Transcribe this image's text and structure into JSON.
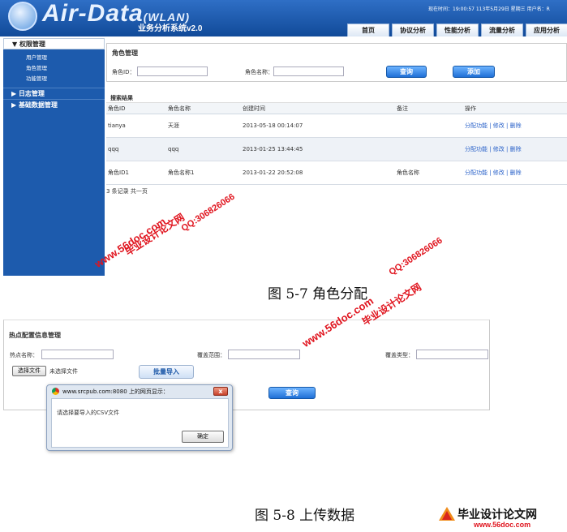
{
  "screen1": {
    "logo_text": "Air-Data",
    "logo_tag": "(WLAN)",
    "system_name": "业务分析系统v2.0",
    "status_text": "现在时间：19:00:57 113年5月29日 星期三    用户名：R",
    "nav_tabs": [
      "首页",
      "协议分析",
      "性能分析",
      "流量分析",
      "应用分析"
    ],
    "sidebar": {
      "sections": [
        {
          "label": "权限管理",
          "expanded": true,
          "items": [
            "用户管理",
            "角色管理",
            "功能管理"
          ]
        },
        {
          "label": "日志管理",
          "expanded": false
        },
        {
          "label": "基础数据管理",
          "expanded": false
        }
      ]
    },
    "search": {
      "title": "角色管理",
      "role_id_label": "角色ID：",
      "role_name_label": "角色名称：",
      "query_button": "查询",
      "add_button": "添加"
    },
    "results": {
      "title": "搜索结果",
      "columns": [
        "角色ID",
        "角色名称",
        "创建时间",
        "备注",
        "操作"
      ],
      "rows": [
        {
          "id": "tianya",
          "name": "天涯",
          "created": "2013-05-18 00:14:07",
          "note": "",
          "ops": "分配功能 | 修改 | 删除"
        },
        {
          "id": "qqq",
          "name": "qqq",
          "created": "2013-01-25 13:44:45",
          "note": "",
          "ops": "分配功能 | 修改 | 删除"
        },
        {
          "id": "角色ID1",
          "name": "角色名称1",
          "created": "2013-01-22 20:52:08",
          "note": "角色名称",
          "ops": "分配功能 | 修改 | 删除"
        }
      ],
      "footer": "3 条记录 共一页"
    }
  },
  "caption1": "图 5-7    角色分配",
  "screen2": {
    "title": "热点配置信息管理",
    "hotspot_label": "热点名称：",
    "coverage_label": "覆盖范围：",
    "coverage_type_label": "覆盖类型：",
    "choose_file_button": "选择文件",
    "no_file_text": "未选择文件",
    "batch_import_button": "批量导入",
    "query_button": "查询",
    "dialog": {
      "title": "www.srcpub.com:8080 上的网页显示：",
      "message": "请选择要导入的CSV文件",
      "ok_button": "确定",
      "close_glyph": "x"
    }
  },
  "caption2": "图 5-8  上传数据",
  "watermarks": {
    "line_a": "毕业设计论文网",
    "line_b": "www.56doc.com",
    "line_c": "QQ:306826066",
    "corner_logo": "毕业设计论文网",
    "corner_url": "www.56doc.com"
  },
  "colors": {
    "header_blue": "#1d5bad",
    "button_blue": "#1f6fd6",
    "watermark_red": "#e0141e",
    "link_blue": "#2a62c9"
  }
}
